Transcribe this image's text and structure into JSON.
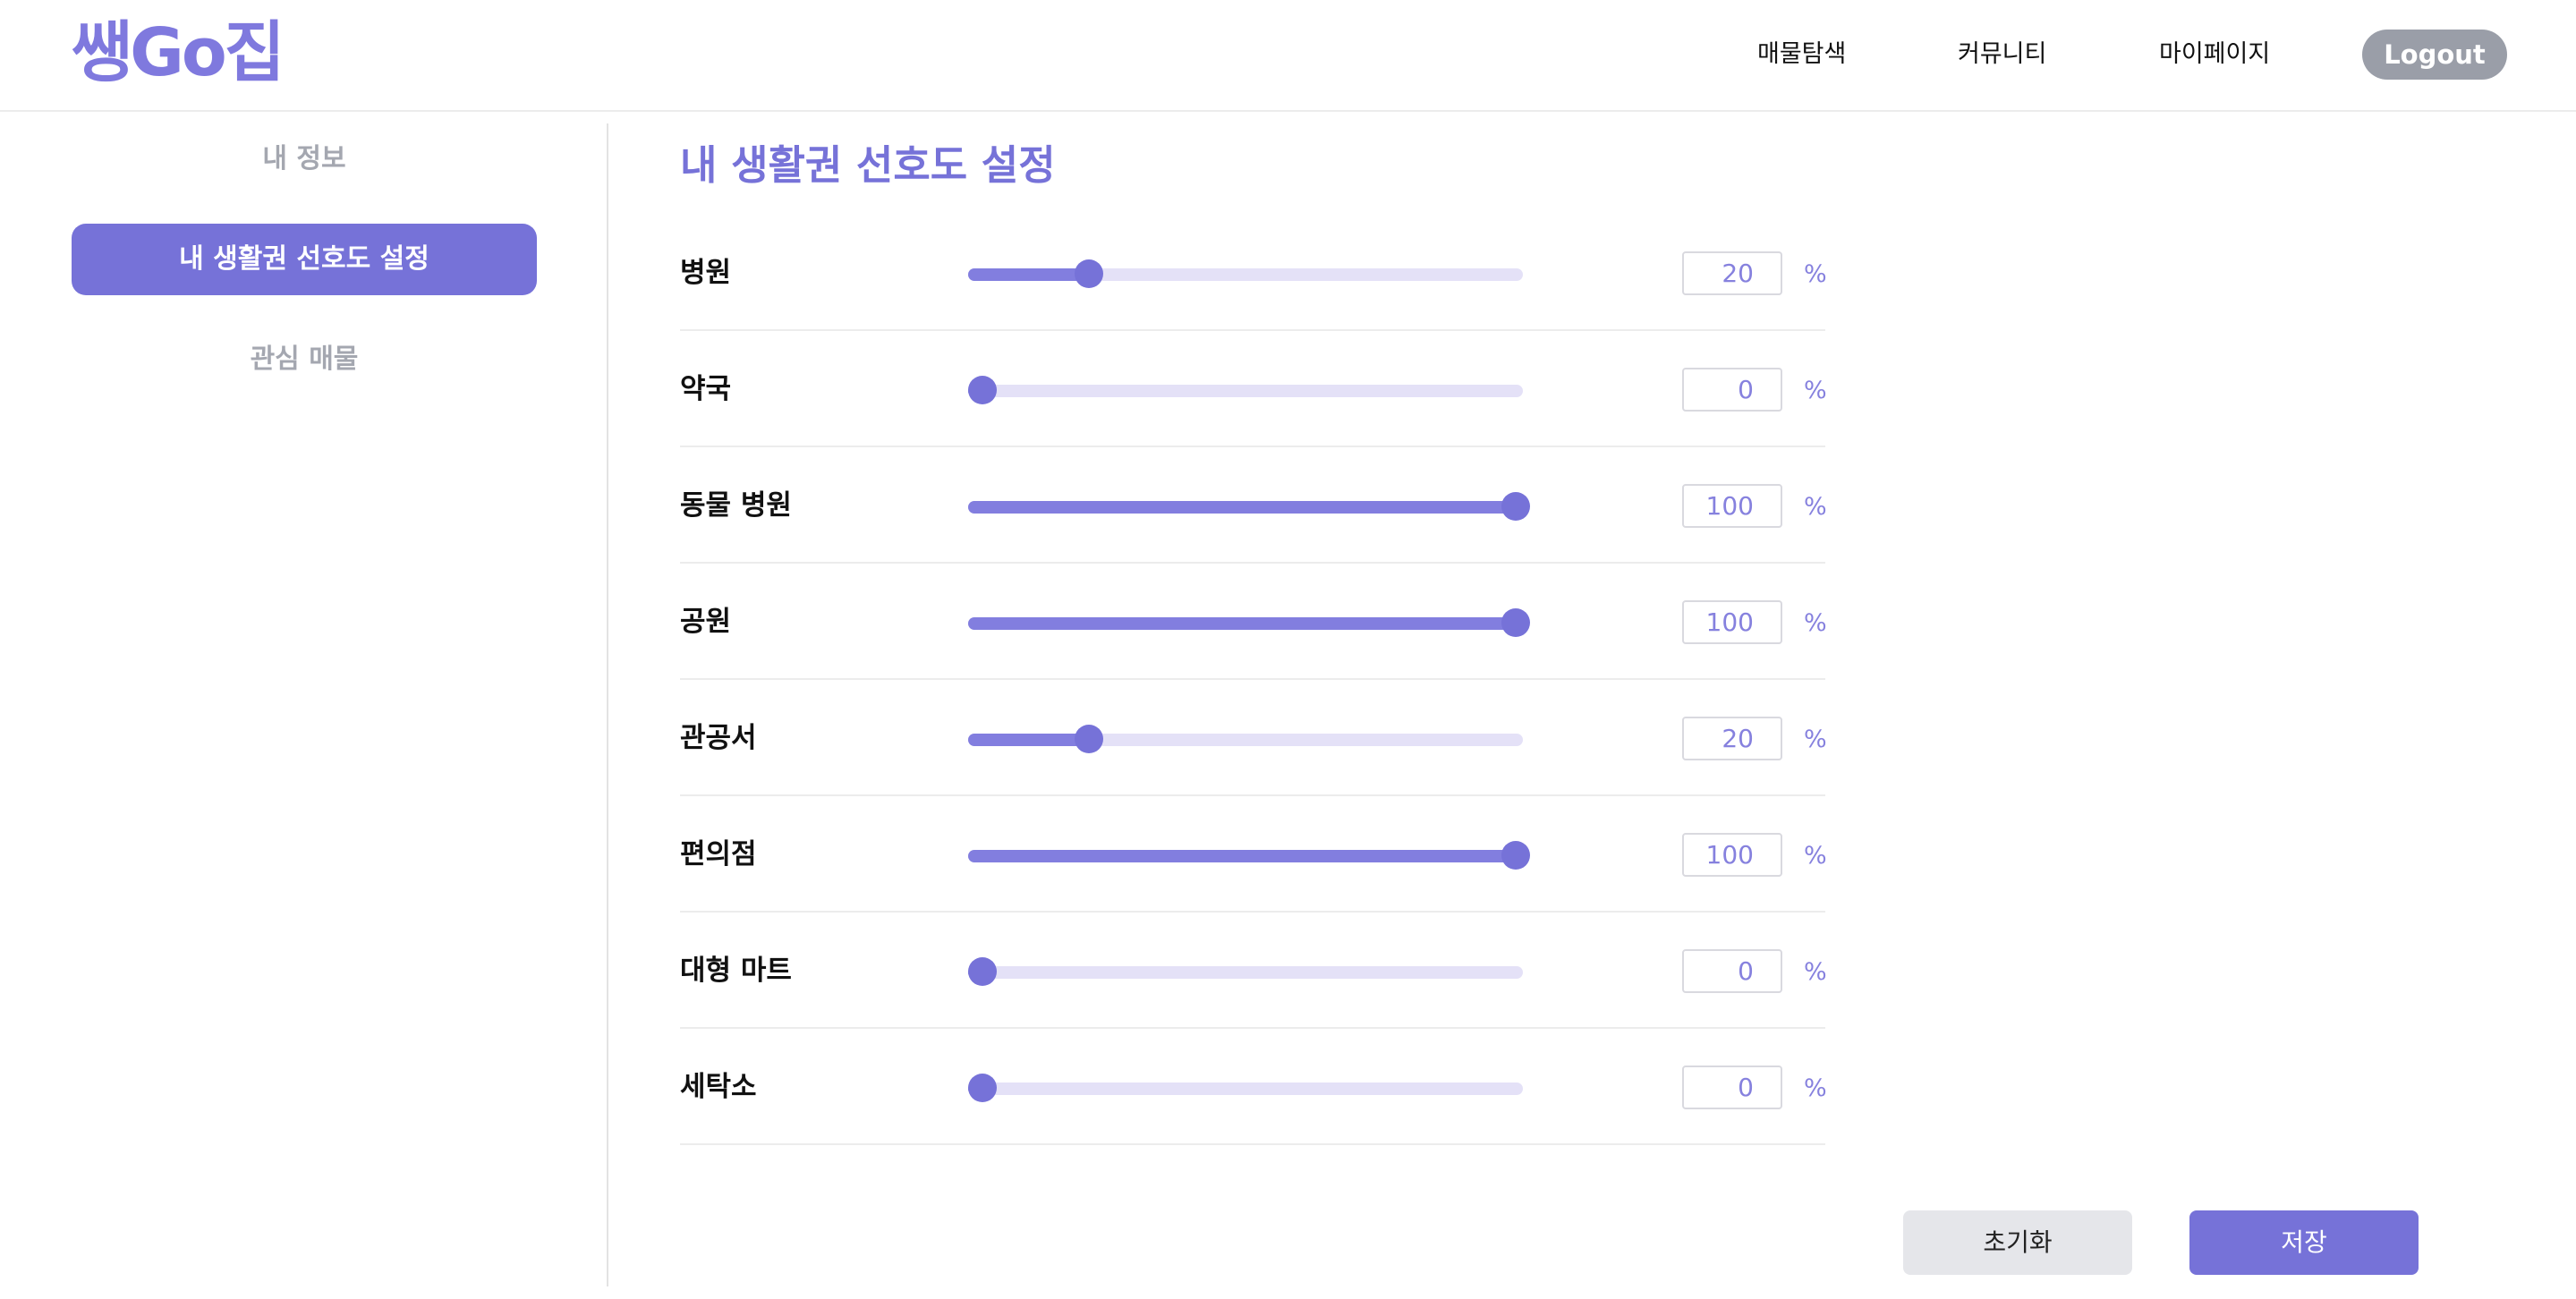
{
  "header": {
    "logo": "쌩Go집",
    "nav": [
      "매물탐색",
      "커뮤니티",
      "마이페이지"
    ],
    "logout": "Logout"
  },
  "sidebar": {
    "items": [
      {
        "label": "내 정보",
        "active": false
      },
      {
        "label": "내 생활권 선호도 설정",
        "active": true
      },
      {
        "label": "관심 매물",
        "active": false
      }
    ]
  },
  "main": {
    "title": "내 생활권 선호도 설정",
    "unit": "%",
    "preferences": [
      {
        "label": "병원",
        "value": 20
      },
      {
        "label": "약국",
        "value": 0
      },
      {
        "label": "동물 병원",
        "value": 100
      },
      {
        "label": "공원",
        "value": 100
      },
      {
        "label": "관공서",
        "value": 20
      },
      {
        "label": "편의점",
        "value": 100
      },
      {
        "label": "대형 마트",
        "value": 0
      },
      {
        "label": "세탁소",
        "value": 0
      }
    ],
    "reset_label": "초기화",
    "save_label": "저장"
  },
  "colors": {
    "accent": "#7672d8",
    "track": "#e4e1f7",
    "logout": "#9a9ea8"
  }
}
